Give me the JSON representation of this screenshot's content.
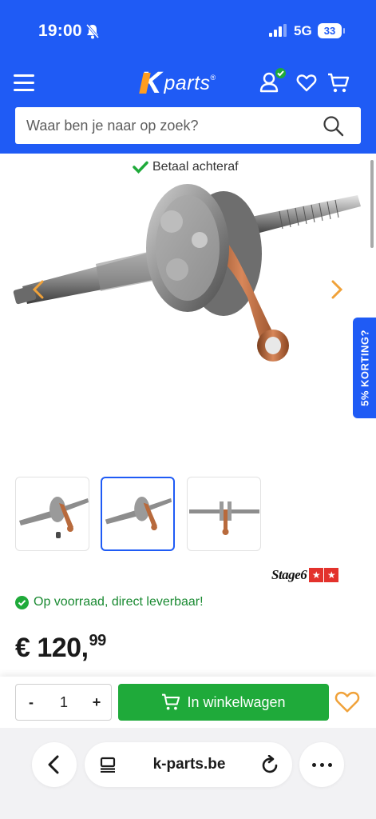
{
  "status": {
    "time": "19:00",
    "network": "5G",
    "battery": "33"
  },
  "header": {
    "logo_text": "parts",
    "search": {
      "placeholder": "Waar ben je naar op zoek?"
    }
  },
  "product": {
    "pay_later": "Betaal achteraf",
    "discount_tab": "5% KORTING?",
    "brand": "Stage6",
    "stock": "Op voorraad, direct leverbaar!",
    "price_main": "€ 120,",
    "price_cents": "99",
    "thumbnails": [
      "thumbnail-1",
      "thumbnail-2",
      "thumbnail-3"
    ],
    "selected_thumbnail": 2
  },
  "cart": {
    "quantity": "1",
    "minus": "-",
    "plus": "+",
    "add_label": "In winkelwagen"
  },
  "browser": {
    "url": "k-parts.be"
  },
  "colors": {
    "brand_blue": "#1f5bf5",
    "cta_green": "#1faa3a",
    "accent_orange": "#ff9d1f"
  }
}
